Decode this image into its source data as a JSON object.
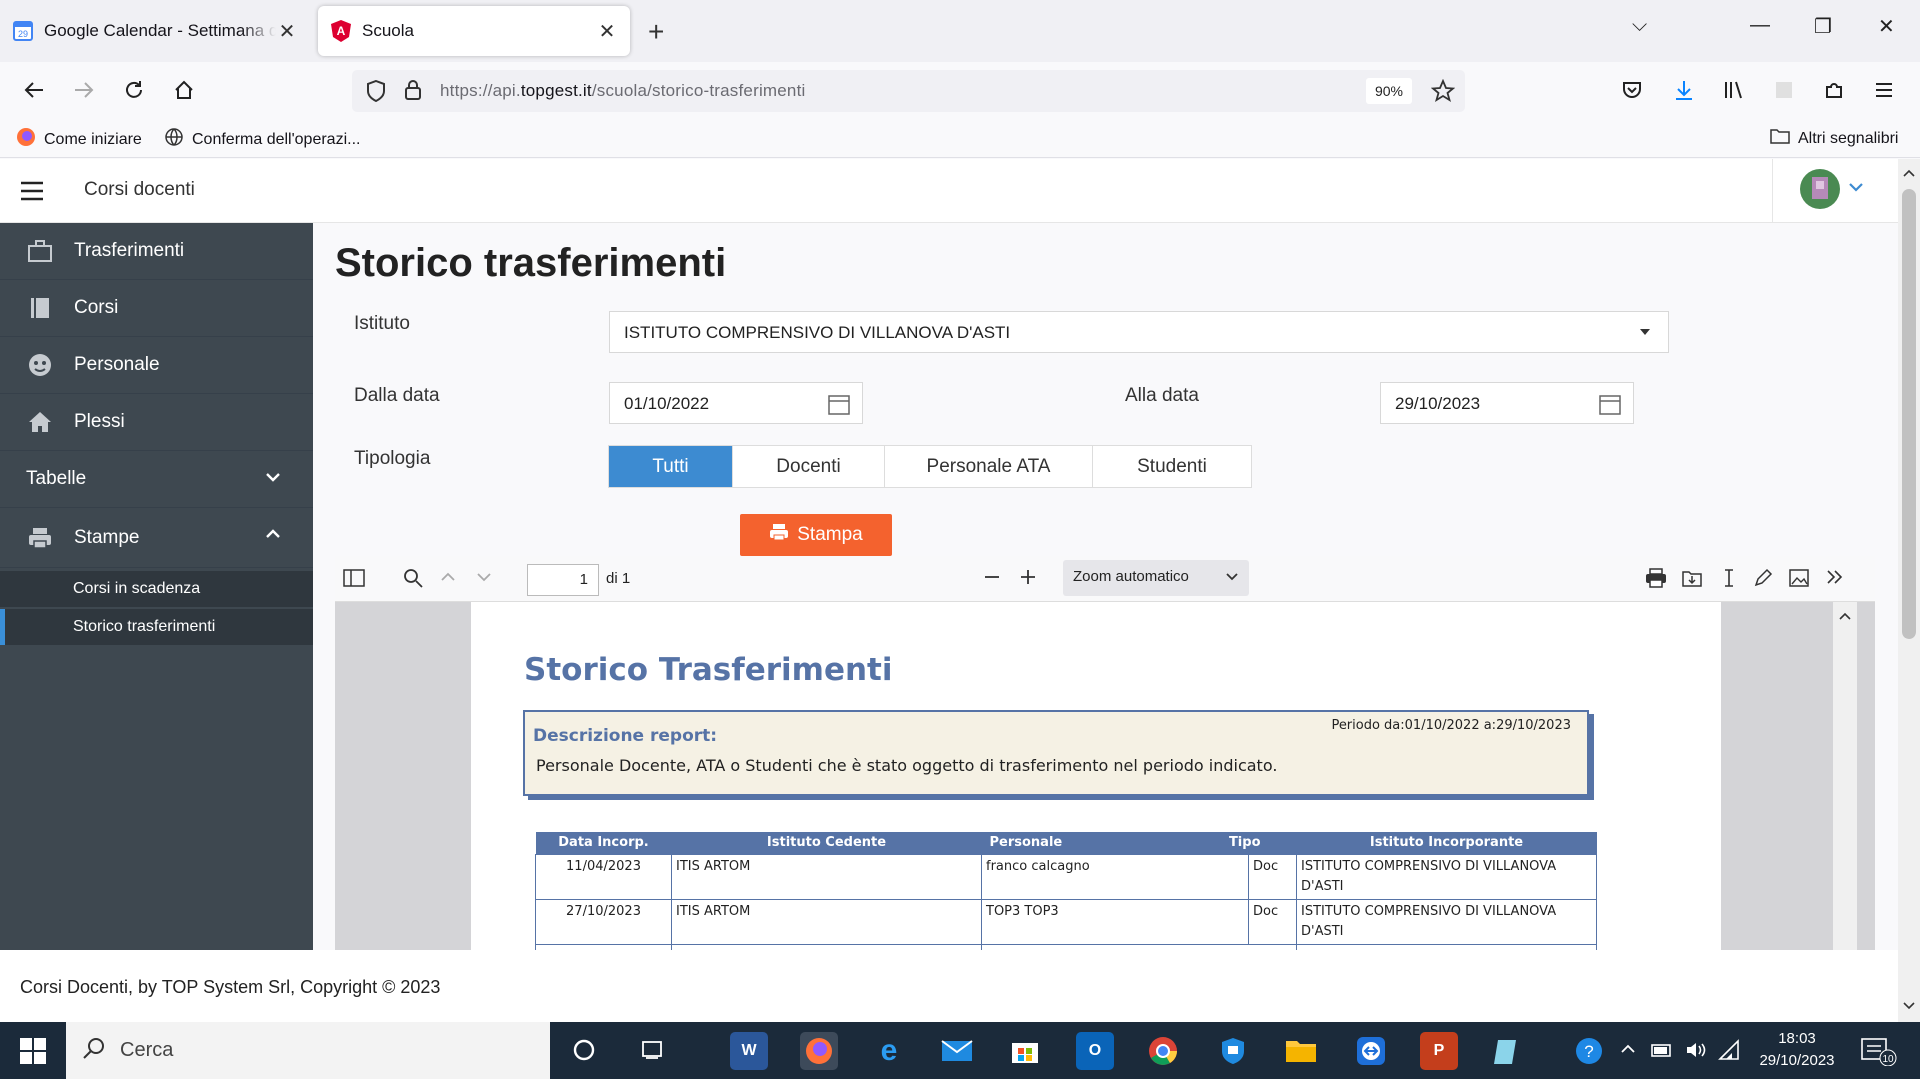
{
  "browser": {
    "tabs": [
      {
        "title": "Google Calendar - Settimana di",
        "active": false
      },
      {
        "title": "Scuola",
        "active": true
      }
    ],
    "url_prefix": "https://api.",
    "url_domain": "topgest.it",
    "url_path": "/scuola/storico-trasferimenti",
    "zoom": "90%",
    "bookmarks": [
      "Come iniziare",
      "Conferma dell'operazi...",
      "Altri segnalibri"
    ]
  },
  "app": {
    "header_title": "Corsi docenti",
    "sidebar": {
      "items": [
        "Trasferimenti",
        "Corsi",
        "Personale",
        "Plessi"
      ],
      "group_tabelle": "Tabelle",
      "group_stampe": "Stampe",
      "sub_items": [
        "Corsi in scadenza",
        "Storico trasferimenti"
      ]
    },
    "page_title": "Storico trasferimenti",
    "form": {
      "istituto_label": "Istituto",
      "istituto_value": "ISTITUTO COMPRENSIVO DI VILLANOVA D'ASTI",
      "dalla_label": "Dalla data",
      "dalla_value": "01/10/2022",
      "alla_label": "Alla data",
      "alla_value": "29/10/2023",
      "tipologia_label": "Tipologia",
      "tipologia_options": [
        "Tutti",
        "Docenti",
        "Personale ATA",
        "Studenti"
      ],
      "tipologia_selected": "Tutti",
      "print_label": "Stampa"
    },
    "pdf_viewer": {
      "page_current": "1",
      "page_total": "di 1",
      "zoom_label": "Zoom automatico"
    },
    "report": {
      "title": "Storico Trasferimenti",
      "period": "Periodo da:01/10/2022 a:29/10/2023",
      "desc_heading": "Descrizione report:",
      "desc_text": "Personale Docente, ATA o Studenti che è stato oggetto di trasferimento nel periodo indicato.",
      "columns": [
        "Data Incorp.",
        "Istituto Cedente",
        "Personale",
        "Tipo",
        "Istituto Incorporante"
      ],
      "rows": [
        [
          "11/04/2023",
          "ITIS ARTOM",
          "franco calcagno",
          "Doc",
          "ISTITUTO COMPRENSIVO DI VILLANOVA D'ASTI"
        ],
        [
          "27/10/2023",
          "ITIS ARTOM",
          "TOP3 TOP3",
          "Doc",
          "ISTITUTO COMPRENSIVO DI VILLANOVA D'ASTI"
        ]
      ]
    },
    "footer": "Corsi Docenti, by TOP System Srl, Copyright © 2023"
  },
  "taskbar": {
    "search_placeholder": "Cerca",
    "time": "18:03",
    "date": "29/10/2023",
    "notifications": "10"
  },
  "colors": {
    "sidebar_bg": "#3e4850",
    "accent_blue": "#3d8bd1",
    "print_orange": "#f4622e",
    "report_blue": "#5673a6"
  }
}
